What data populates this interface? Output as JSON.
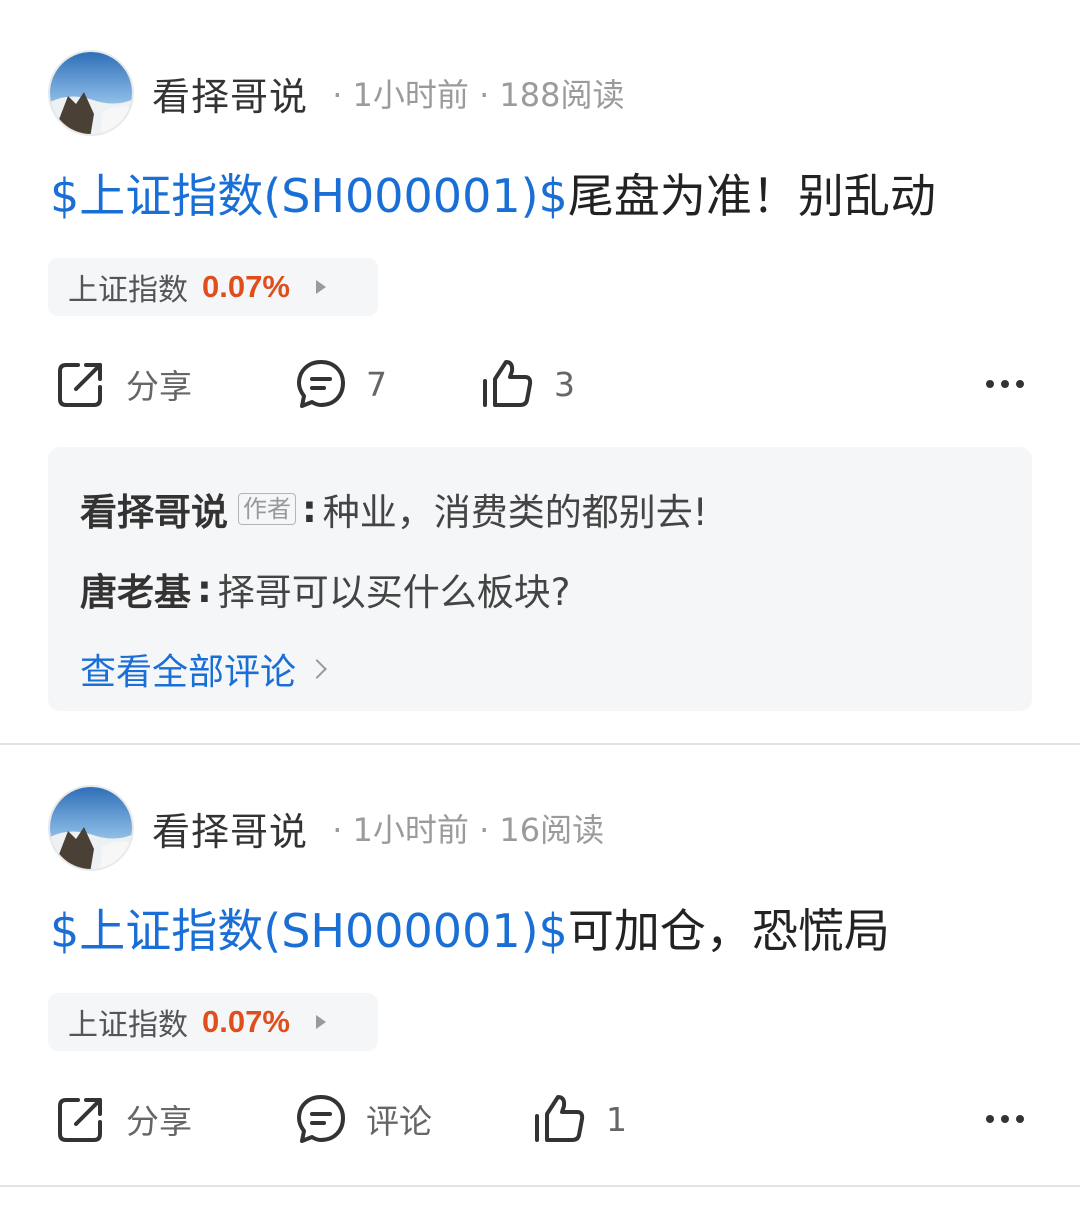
{
  "posts": [
    {
      "author": "看择哥说",
      "time": "1小时前",
      "reads": "188阅读",
      "stock_link": "$上证指数(SH000001)$",
      "text": "尾盘为准！别乱动",
      "tag": {
        "name": "上证指数",
        "change": "0.07%"
      },
      "actions": {
        "share": "分享",
        "comment": "7",
        "like": "3"
      },
      "comments": [
        {
          "author": "看择哥说",
          "badge": "作者",
          "text": "种业，消费类的都别去!"
        },
        {
          "author": "唐老基",
          "text": "择哥可以买什么板块?"
        }
      ],
      "view_all": "查看全部评论"
    },
    {
      "author": "看择哥说",
      "time": "1小时前",
      "reads": "16阅读",
      "stock_link": "$上证指数(SH000001)$",
      "text": "可加仓，恐慌局",
      "tag": {
        "name": "上证指数",
        "change": "0.07%"
      },
      "actions": {
        "share": "分享",
        "comment": "评论",
        "like": "1"
      }
    }
  ],
  "colors": {
    "link": "#1a6fd6",
    "change_up": "#e04e1c",
    "panel_bg": "#f5f6f8"
  },
  "icons": [
    "share-icon",
    "comment-icon",
    "like-icon",
    "more-icon",
    "chevron-right-icon"
  ]
}
